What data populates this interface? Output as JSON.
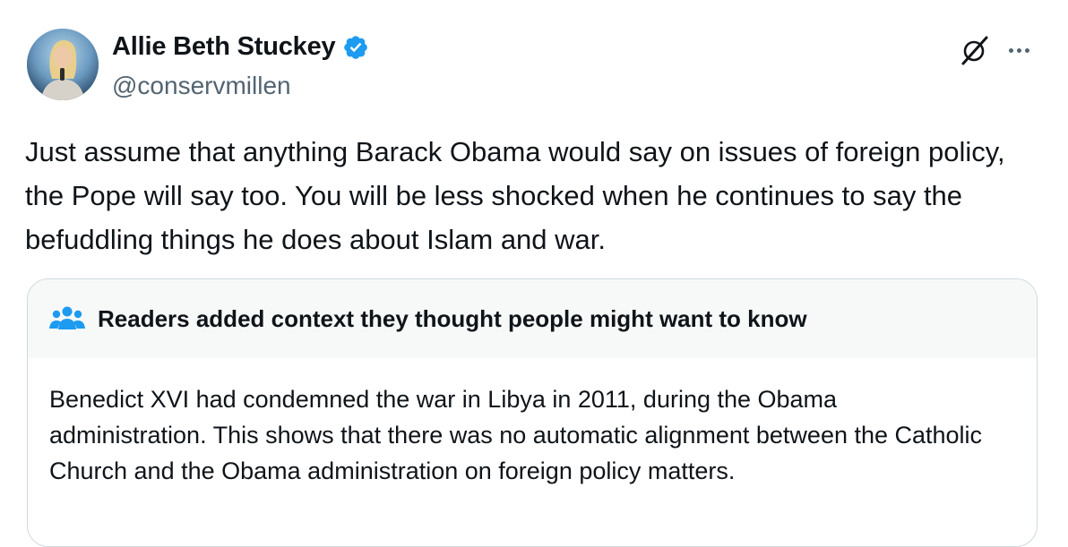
{
  "author": {
    "name": "Allie Beth Stuckey",
    "handle": "@conservmillen",
    "verified": true
  },
  "icons": {
    "avatar": "profile-photo",
    "verified": "verified-badge-icon",
    "grok": "grok-icon",
    "more": "more-options-icon",
    "note": "people-icon"
  },
  "tweet": {
    "text": "Just assume that anything Barack Obama would say on issues of foreign policy, the Pope will say too. You will be less shocked when he continues to say the befuddling things he does about Islam and war."
  },
  "community_note": {
    "title": "Readers added context they thought people might want to know",
    "body": "Benedict XVI had condemned the war in Libya in 2011, during the Obama administration. This shows that there was no automatic alignment between the Catholic Church and the Obama administration on foreign policy matters."
  },
  "colors": {
    "verified_blue": "#1d9bf0",
    "note_icon_blue": "#1d9bf0",
    "secondary_text": "#536471",
    "border": "#cfd9de"
  }
}
